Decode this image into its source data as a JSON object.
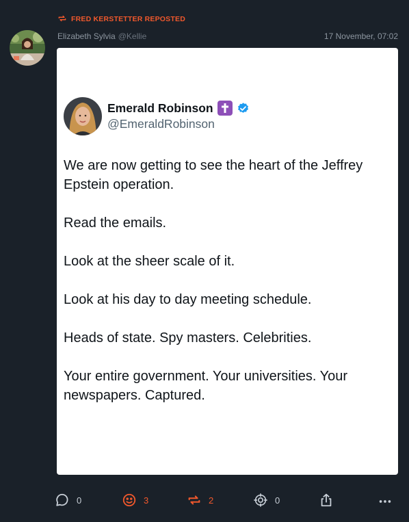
{
  "repost": {
    "label": "FRED KERSTETTER REPOSTED",
    "color": "#f0582c"
  },
  "post": {
    "author_name": "Elizabeth Sylvia",
    "author_handle": "@Kellie",
    "timestamp": "17 November, 07:02"
  },
  "embed": {
    "name": "Emerald Robinson",
    "handle": "@EmeraldRobinson",
    "paragraphs": [
      "We are now getting to see the heart of the Jeffrey Epstein operation.",
      "Read the emails.",
      "Look at the sheer scale of it.",
      "Look at his day to day meeting schedule.",
      "Heads of state. Spy masters. Celebrities.",
      "Your entire government. Your universities. Your newspapers. Captured."
    ]
  },
  "actions": {
    "reply_count": "0",
    "react_count": "3",
    "repost_count": "2",
    "quote_count": "0"
  },
  "colors": {
    "background": "#1a2129",
    "accent": "#f0582c",
    "verified": "#1d9bf0"
  },
  "icons": [
    "repost-icon",
    "speech-bubble-icon",
    "smiley-icon",
    "crosshair-icon",
    "share-icon",
    "more-icon",
    "verified-icon",
    "cross-icon"
  ]
}
